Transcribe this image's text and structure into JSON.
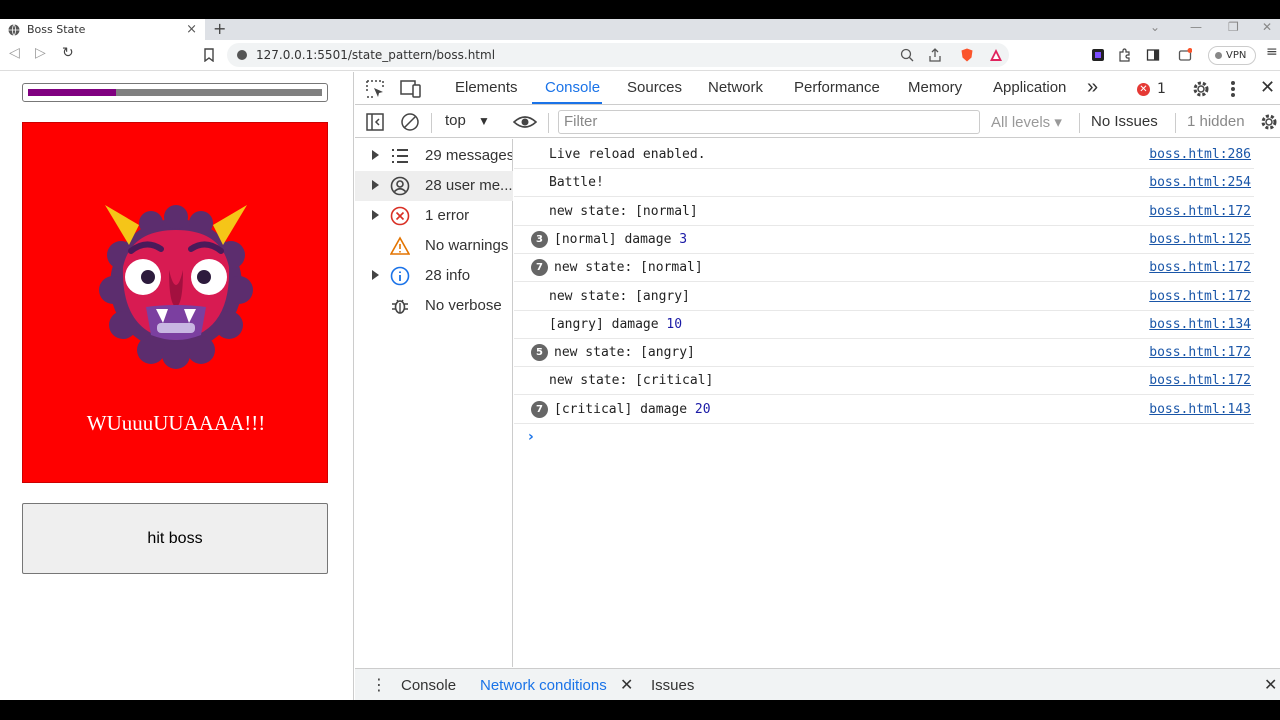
{
  "browser": {
    "tab_title": "Boss State",
    "tab_close": "×",
    "new_tab": "+",
    "url": "127.0.0.1:5501/state_pattern/boss.html",
    "vpn_label": "VPN"
  },
  "page": {
    "health_fraction": 0.3,
    "boss_shout": "WUuuuUUAAAA!!!",
    "hit_button_label": "hit boss",
    "boss_bg_color": "#ff0000",
    "health_fill_color": "#800080"
  },
  "devtools": {
    "tabs": [
      "Elements",
      "Console",
      "Sources",
      "Network",
      "Performance",
      "Memory",
      "Application"
    ],
    "more_tabs": "»",
    "active_tab": "Console",
    "error_count": "1",
    "context": "top",
    "filter_placeholder": "Filter",
    "levels": "All levels ▾",
    "no_issues": "No Issues",
    "hidden": "1 hidden",
    "sidebar": [
      {
        "label": "29 messages",
        "icon": "list-icon"
      },
      {
        "label": "28 user me...",
        "icon": "user-icon"
      },
      {
        "label": "1 error",
        "icon": "error-icon"
      },
      {
        "label": "No warnings",
        "icon": "warning-icon"
      },
      {
        "label": "28 info",
        "icon": "info-icon"
      },
      {
        "label": "No verbose",
        "icon": "bug-icon"
      }
    ],
    "messages": [
      {
        "count": "",
        "text": "Live reload enabled.",
        "num": "",
        "source": "boss.html:286"
      },
      {
        "count": "",
        "text": "Battle!",
        "num": "",
        "source": "boss.html:254"
      },
      {
        "count": "",
        "text": "new state: [normal]",
        "num": "",
        "source": "boss.html:172"
      },
      {
        "count": "3",
        "text": "[normal] damage ",
        "num": "3",
        "source": "boss.html:125"
      },
      {
        "count": "7",
        "text": "new state: [normal]",
        "num": "",
        "source": "boss.html:172"
      },
      {
        "count": "",
        "text": "new state: [angry]",
        "num": "",
        "source": "boss.html:172"
      },
      {
        "count": "",
        "text": "[angry] damage ",
        "num": "10",
        "source": "boss.html:134"
      },
      {
        "count": "5",
        "text": "new state: [angry]",
        "num": "",
        "source": "boss.html:172"
      },
      {
        "count": "",
        "text": "new state: [critical]",
        "num": "",
        "source": "boss.html:172"
      },
      {
        "count": "7",
        "text": "[critical] damage ",
        "num": "20",
        "source": "boss.html:143"
      }
    ],
    "prompt": "›",
    "drawer_tabs": [
      "Console",
      "Network conditions",
      "Issues"
    ],
    "drawer_active": "Network conditions",
    "accent_color": "#1a73e8"
  }
}
